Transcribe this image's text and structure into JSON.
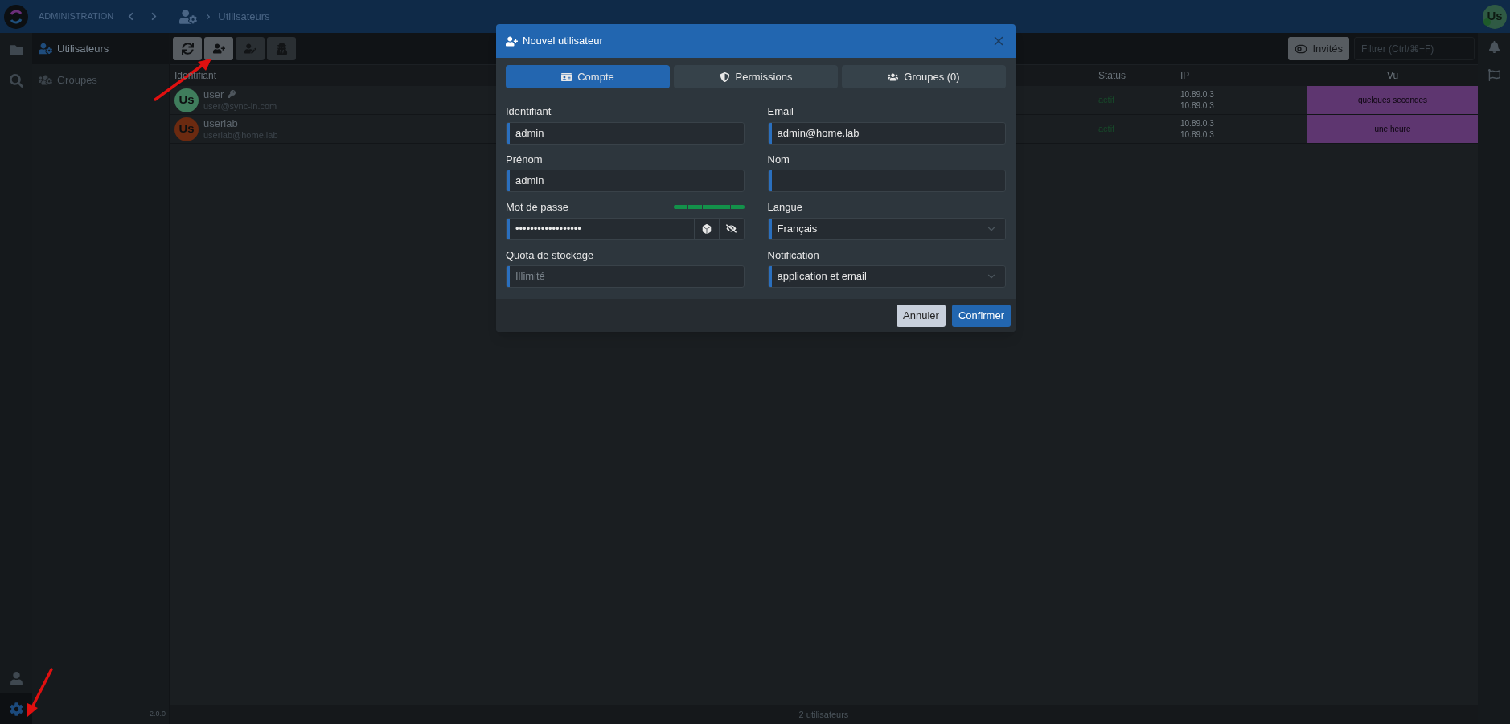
{
  "topbar": {
    "section": "ADMINISTRATION",
    "breadcrumb": "Utilisateurs",
    "avatar": "Us"
  },
  "rail": {
    "top": [
      {
        "kind": "files",
        "selected": false
      },
      {
        "kind": "search",
        "selected": false
      }
    ],
    "bottom": [
      {
        "kind": "user",
        "selected": false
      },
      {
        "kind": "settings",
        "selected": true
      }
    ]
  },
  "sidebar": {
    "items": [
      {
        "kind": "users",
        "label": "Utilisateurs",
        "selected": true
      },
      {
        "kind": "groups",
        "label": "Groupes",
        "selected": false
      }
    ],
    "version": "2.0.0"
  },
  "toolbar": {
    "buttons": [
      {
        "kind": "refresh",
        "disabled": false
      },
      {
        "kind": "add",
        "disabled": false
      },
      {
        "kind": "edit",
        "disabled": true
      },
      {
        "kind": "impersonate",
        "disabled": true
      }
    ],
    "guests": "Invités",
    "filter": {
      "placeholder": "Filtrer (Ctrl/⌘+F)"
    }
  },
  "table": {
    "columns": [
      "Identifiant",
      "Status",
      "IP",
      "Vu"
    ],
    "rows": [
      {
        "name": "user",
        "admin": true,
        "email": "user@sync-in.com",
        "avatar": "Us",
        "color": "#3f7d5c",
        "status": "actif",
        "ip": [
          "10.89.0.3",
          "10.89.0.3"
        ],
        "seen": "quelques secondes"
      },
      {
        "name": "userlab",
        "admin": false,
        "email": "userlab@home.lab",
        "avatar": "Us",
        "color": "#6b2a10",
        "status": "actif",
        "ip": [
          "10.89.0.3",
          "10.89.0.3"
        ],
        "seen": "une heure"
      }
    ]
  },
  "status_bar": "2 utilisateurs",
  "dialog": {
    "title": "Nouvel utilisateur",
    "tabs": [
      {
        "kind": "account",
        "label": "Compte",
        "selected": true
      },
      {
        "kind": "permissions",
        "label": "Permissions",
        "selected": false
      },
      {
        "kind": "groups",
        "label": "Groupes (0)",
        "selected": false
      }
    ],
    "fields": [
      {
        "kind": "text",
        "label": "Identifiant",
        "value": "admin"
      },
      {
        "kind": "text",
        "label": "Email",
        "value": "admin@home.lab"
      },
      {
        "kind": "text",
        "label": "Prénom",
        "value": "admin"
      },
      {
        "kind": "text",
        "label": "Nom"
      },
      {
        "kind": "password",
        "label": "Mot de passe",
        "value": "••••••••••••••••••",
        "level": 1
      },
      {
        "kind": "select",
        "label": "Langue",
        "value": "Français"
      },
      {
        "kind": "text",
        "label": "Quota de stockage",
        "placeholder": "Illimité"
      },
      {
        "kind": "select",
        "label": "Notification",
        "value": "application et email"
      }
    ],
    "buttons": [
      {
        "kind": "cancel",
        "label": "Annuler"
      },
      {
        "kind": "confirm",
        "label": "Confirmer"
      }
    ]
  }
}
